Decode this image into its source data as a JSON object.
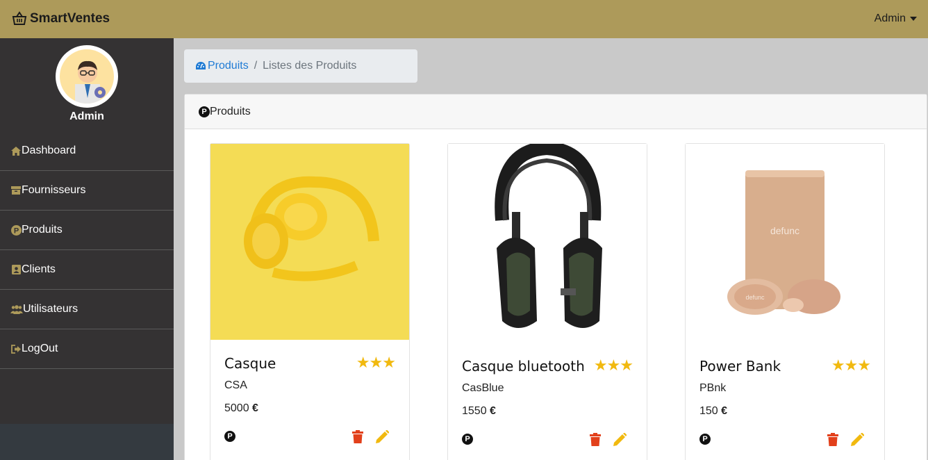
{
  "app": {
    "brand": "SmartVentes",
    "user_menu": "Admin"
  },
  "sidebar": {
    "user_name": "Admin",
    "items": [
      {
        "label": "Dashboard",
        "icon": "home-icon"
      },
      {
        "label": "Fournisseurs",
        "icon": "archive-icon"
      },
      {
        "label": "Produits",
        "icon": "product-p-icon"
      },
      {
        "label": "Clients",
        "icon": "contact-card-icon"
      },
      {
        "label": "Utilisateurs",
        "icon": "users-icon"
      },
      {
        "label": "LogOut",
        "icon": "sign-out-icon"
      }
    ]
  },
  "breadcrumb": {
    "link": "Produits",
    "current": "Listes des Produits"
  },
  "panel": {
    "title": "Produits"
  },
  "products": [
    {
      "name": "Casque",
      "code": "CSA",
      "price": "5000",
      "currency": "€",
      "rating": 3
    },
    {
      "name": "Casque bluetooth",
      "code": "CasBlue",
      "price": "1550",
      "currency": "€",
      "rating": 3
    },
    {
      "name": "Power Bank",
      "code": "PBnk",
      "price": "150",
      "currency": "€",
      "rating": 3
    }
  ],
  "colors": {
    "topbar": "#ad9a5a",
    "sidebar": "#343233",
    "star": "#f1b90f",
    "delete": "#e2401b",
    "edit": "#f1b90f",
    "link": "#1e7ad4"
  }
}
